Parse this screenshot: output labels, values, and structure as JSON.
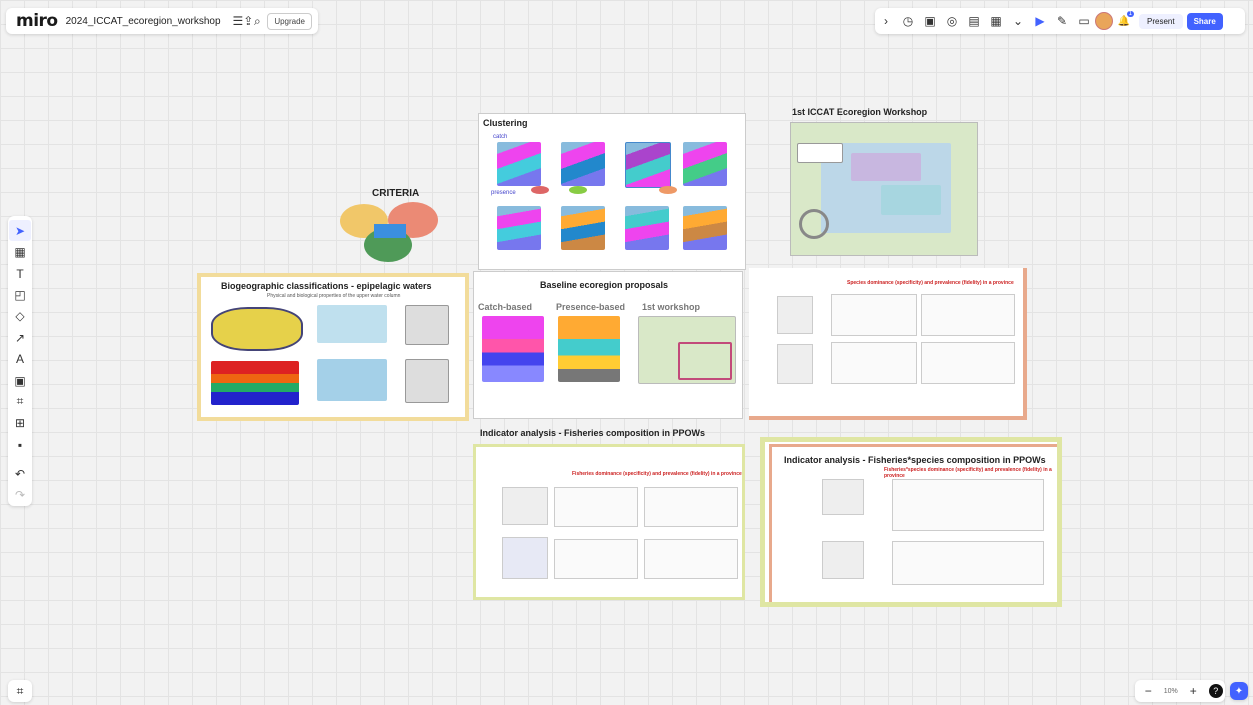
{
  "app": {
    "logo": "miro",
    "board_name": "2024_ICCAT_ecoregion_workshop",
    "upgrade": "Upgrade"
  },
  "toolbar_right": {
    "present": "Present",
    "share": "Share",
    "notification_count": "1"
  },
  "zoom": {
    "level": "10%"
  },
  "icons": {
    "menu": "☰",
    "export": "⇪",
    "search": "⌕",
    "expand": "›",
    "timer": "◷",
    "vote": "▣",
    "focus": "◎",
    "frames": "▤",
    "notes": "▦",
    "more": "⌄",
    "select": "▶",
    "reactions": "✎",
    "comment": "▭",
    "bell": "🔔",
    "cursor": "➤",
    "table": "▦",
    "text": "T",
    "sticky": "◰",
    "shapes": "◇",
    "connector": "↗",
    "pen": "A",
    "card": "▣",
    "frame": "⌗",
    "upload": "⊞",
    "more_tools": "▪",
    "undo": "↶",
    "redo": "↷",
    "minus": "−",
    "plus": "+",
    "help": "?",
    "ai": "✦"
  },
  "frames": {
    "clustering": {
      "title": "Clustering",
      "labels": [
        "catch",
        "presence"
      ]
    },
    "workshop": {
      "title": "1st ICCAT Ecoregion Workshop"
    },
    "criteria": {
      "title": "CRITERIA"
    },
    "biogeo": {
      "title": "Biogeographic classifications - epipelagic waters",
      "subtitle": "Physical and biological properties of the upper water column"
    },
    "baseline": {
      "title": "Baseline ecoregion proposals",
      "columns": [
        "Catch-based",
        "Presence-based",
        "1st workshop"
      ]
    },
    "species": {
      "title": "Species dominance (specificity) and prevalence (fidelity) in a province"
    },
    "fisheries": {
      "title": "Indicator analysis - Fisheries composition in PPOWs",
      "red": "Fisheries dominance (specificity) and prevalence (fidelity) in a province"
    },
    "fish_species": {
      "title": "Indicator analysis - Fisheries*species composition in PPOWs",
      "red": "Fisheries*species dominance (specificity) and prevalence (fidelity) in a province"
    }
  },
  "colors": {
    "accent": "#4262ff",
    "frame_yellow": "#f2dc9b",
    "frame_salmon": "#e8a98c",
    "frame_green": "#dfe6a3"
  }
}
